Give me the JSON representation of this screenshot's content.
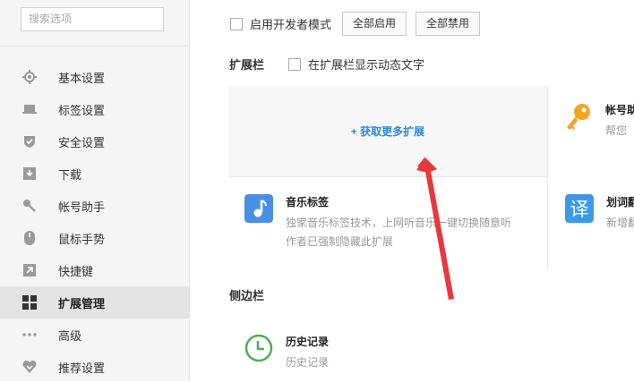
{
  "sidebar": {
    "search_placeholder": "搜索选项",
    "items": [
      {
        "label": "基本设置",
        "icon": "gear-icon"
      },
      {
        "label": "标签设置",
        "icon": "tab-icon"
      },
      {
        "label": "安全设置",
        "icon": "shield-check-icon"
      },
      {
        "label": "下载",
        "icon": "download-icon"
      },
      {
        "label": "帐号助手",
        "icon": "key-icon"
      },
      {
        "label": "鼠标手势",
        "icon": "mouse-icon"
      },
      {
        "label": "快捷键",
        "icon": "shortcut-arrow-icon"
      },
      {
        "label": "扩展管理",
        "icon": "grid-icon",
        "active": true
      },
      {
        "label": "高级",
        "icon": "more-dots-icon"
      },
      {
        "label": "推荐设置",
        "icon": "heart-icon"
      }
    ]
  },
  "main": {
    "dev_mode_label": "启用开发者模式",
    "enable_all": "全部启用",
    "disable_all": "全部禁用",
    "toolbar_section": "扩展栏",
    "toolbar_dynamic_text": "在扩展栏显示动态文字",
    "get_more": "获取更多扩展",
    "extensions": [
      {
        "title": "帐号助",
        "desc": "帮您",
        "color": "#f5a623"
      },
      {
        "title": "音乐标签",
        "desc1": "独家音乐标签技术，上网听音乐一键切换随意听",
        "desc2": "作者已强制隐藏此扩展",
        "color": "#4a90e2"
      },
      {
        "title": "划词翻",
        "desc": "新增翻",
        "color": "#3a9ae8"
      }
    ],
    "sidebar_section": "侧边栏",
    "history": {
      "title": "历史记录",
      "desc": "历史记录",
      "color": "#4caf50"
    },
    "arrow_color": "#e8383d"
  }
}
